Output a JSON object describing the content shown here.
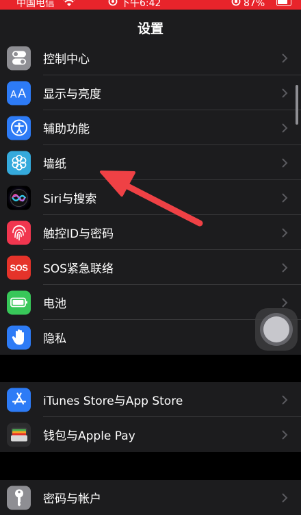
{
  "status_bar": {
    "carrier": "中国电信",
    "time": "下午6:42",
    "battery": "87%"
  },
  "nav": {
    "title": "设置"
  },
  "group1": [
    {
      "label": "控制中心",
      "icon": "toggle-switches-icon",
      "color": "#8e8e93"
    },
    {
      "label": "显示与亮度",
      "icon": "text-size-icon",
      "color": "#2d7bf6"
    },
    {
      "label": "辅助功能",
      "icon": "accessibility-icon",
      "color": "#2d7bf6"
    },
    {
      "label": "墙纸",
      "icon": "flower-icon",
      "color": "#35aadc"
    },
    {
      "label": "Siri与搜索",
      "icon": "siri-icon",
      "color": "#1c1c1e"
    },
    {
      "label": "触控ID与密码",
      "icon": "fingerprint-icon",
      "color": "#f1364f"
    },
    {
      "label": "SOS紧急联络",
      "icon": "sos-icon",
      "color": "#e5332a",
      "icon_text": "SOS"
    },
    {
      "label": "电池",
      "icon": "battery-icon",
      "color": "#38c759"
    },
    {
      "label": "隐私",
      "icon": "hand-icon",
      "color": "#2d7bf6"
    }
  ],
  "group2": [
    {
      "label": "iTunes Store与App Store",
      "icon": "app-store-icon",
      "color": "#2d7bf6"
    },
    {
      "label": "钱包与Apple Pay",
      "icon": "wallet-icon",
      "color": "#2c2c2e"
    }
  ],
  "group3": [
    {
      "label": "密码与帐户",
      "icon": "key-icon",
      "color": "#8e8e93"
    }
  ],
  "colors": {
    "background": "#000000",
    "cell": "#1c1c1e",
    "separator": "#38383a",
    "status_bar": "#e8242b",
    "annotation_arrow": "#ef4145"
  }
}
